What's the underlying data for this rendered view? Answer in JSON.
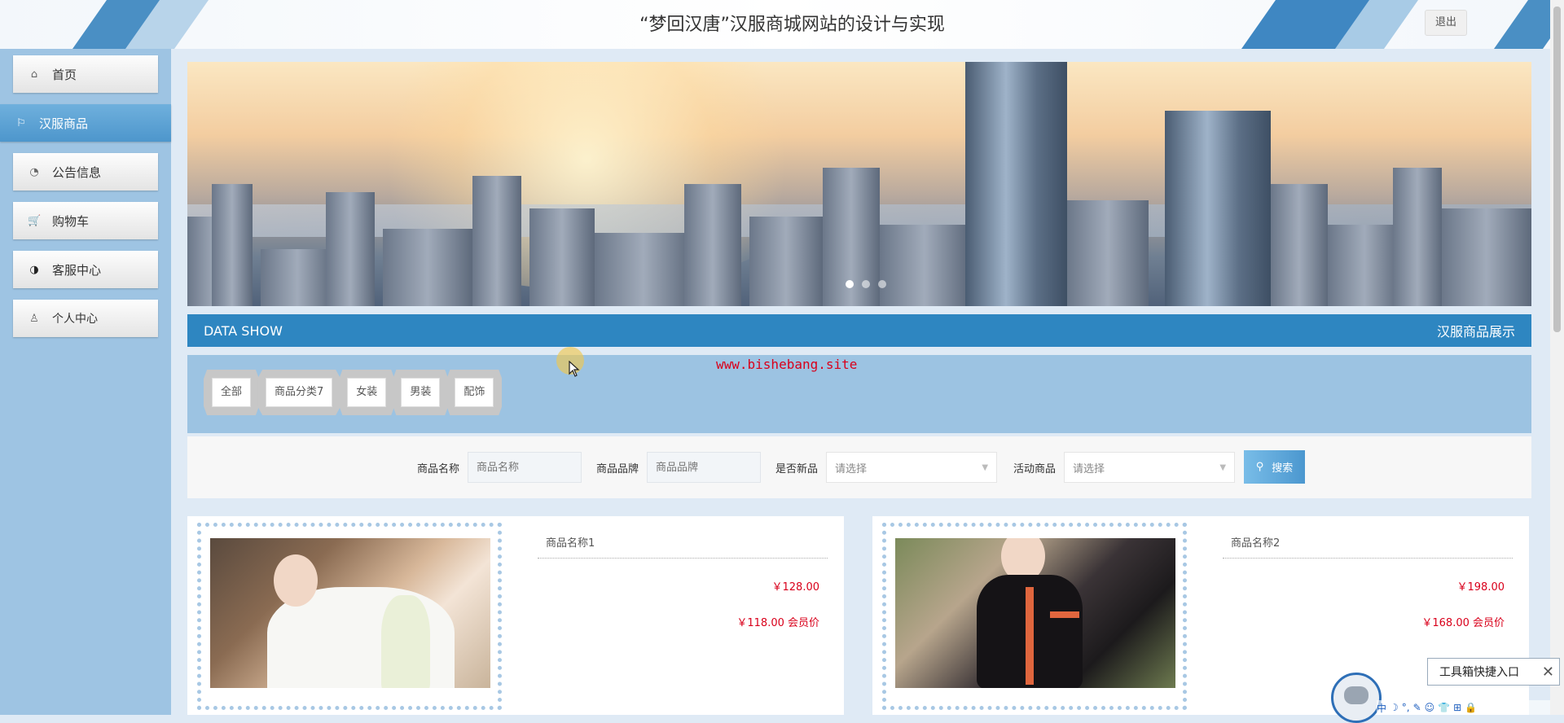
{
  "header": {
    "title": "“梦回汉唐”汉服商城网站的设计与实现",
    "logout_label": "退出"
  },
  "sidebar": {
    "items": [
      {
        "label": "首页",
        "icon": "home-icon",
        "active": false
      },
      {
        "label": "汉服商品",
        "icon": "flag-icon",
        "active": true
      },
      {
        "label": "公告信息",
        "icon": "dashboard-icon",
        "active": false
      },
      {
        "label": "购物车",
        "icon": "cart-icon",
        "active": false
      },
      {
        "label": "客服中心",
        "icon": "support-icon",
        "active": false
      },
      {
        "label": "个人中心",
        "icon": "user-icon",
        "active": false
      }
    ]
  },
  "banner": {
    "slide_count": 3,
    "active_slide": 1
  },
  "section": {
    "en_title": "DATA SHOW",
    "cn_title": "汉服商品展示"
  },
  "categories": [
    "全部",
    "商品分类7",
    "女装",
    "男装",
    "配饰"
  ],
  "watermark": "www.bishebang.site",
  "search": {
    "name_label": "商品名称",
    "name_placeholder": "商品名称",
    "brand_label": "商品品牌",
    "brand_placeholder": "商品品牌",
    "new_label": "是否新品",
    "new_value": "请选择",
    "promo_label": "活动商品",
    "promo_value": "请选择",
    "button_label": "搜索"
  },
  "products": [
    {
      "name": "商品名称1",
      "price": "￥128.00",
      "vip_price": "￥118.00 会员价"
    },
    {
      "name": "商品名称2",
      "price": "￥198.00",
      "vip_price": "￥168.00 会员价"
    }
  ],
  "toolbox": {
    "label": "工具箱快捷入口",
    "close": "✕"
  },
  "ime": [
    "中",
    "☽",
    "°,",
    "✎",
    "☺",
    "👕",
    "⊞",
    "🔒"
  ],
  "colors": {
    "accent": "#2e86c1",
    "sidebar_bg": "#9ec4e3",
    "price_red": "#d9001b"
  }
}
